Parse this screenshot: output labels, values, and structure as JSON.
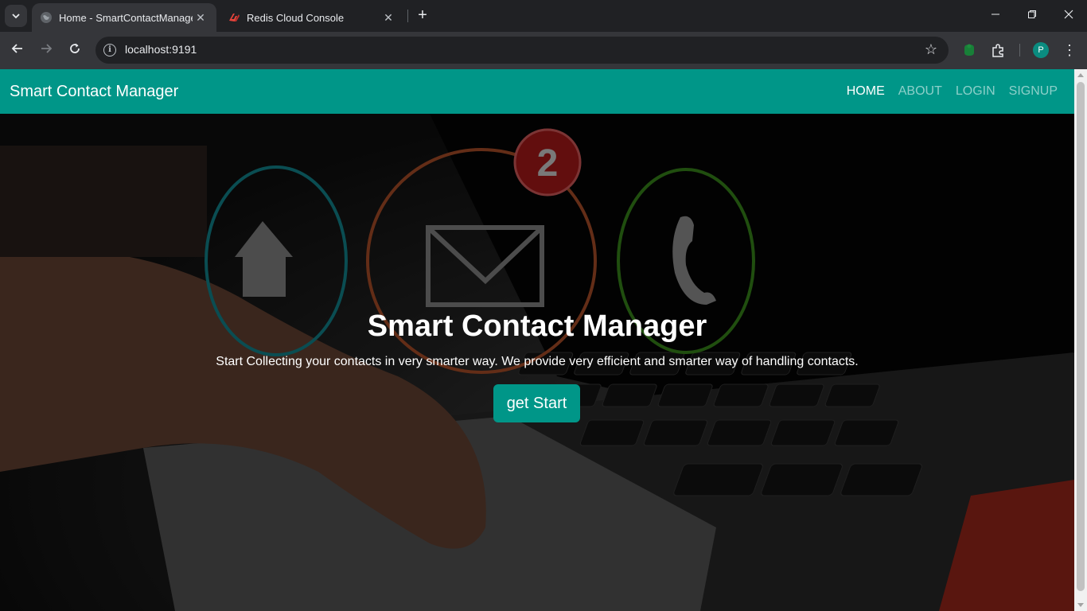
{
  "browser": {
    "tabs": [
      {
        "title": "Home - SmartContactManager",
        "favicon": "globe-icon",
        "active": true
      },
      {
        "title": "Redis Cloud Console",
        "favicon": "redis-icon",
        "active": false
      }
    ],
    "url": "localhost:9191",
    "profile_initial": "P",
    "icons": {
      "tab_search": "chevron-down-icon",
      "new_tab": "plus-icon",
      "back": "back-arrow-icon",
      "forward": "forward-arrow-icon",
      "reload": "reload-icon",
      "site_info": "info-icon",
      "bookmark": "star-icon",
      "extension_green": "extension-icon",
      "extensions": "puzzle-icon",
      "menu": "kebab-menu-icon"
    }
  },
  "navbar": {
    "brand": "Smart Contact Manager",
    "links": [
      {
        "label": "HOME",
        "active": true
      },
      {
        "label": "ABOUT",
        "active": false
      },
      {
        "label": "LOGIN",
        "active": false
      },
      {
        "label": "SIGNUP",
        "active": false
      }
    ]
  },
  "hero": {
    "title": "Smart Contact Manager",
    "subtitle": "Start Collecting your contacts in very smarter way. We provide very efficient and smarter way of handling contacts.",
    "cta_label": "get Start",
    "badge_count": "2",
    "background_icons": [
      "home-icon",
      "envelope-icon",
      "phone-icon"
    ]
  },
  "colors": {
    "brand": "#009688",
    "chrome_dark": "#202124",
    "chrome_toolbar": "#35363a"
  }
}
